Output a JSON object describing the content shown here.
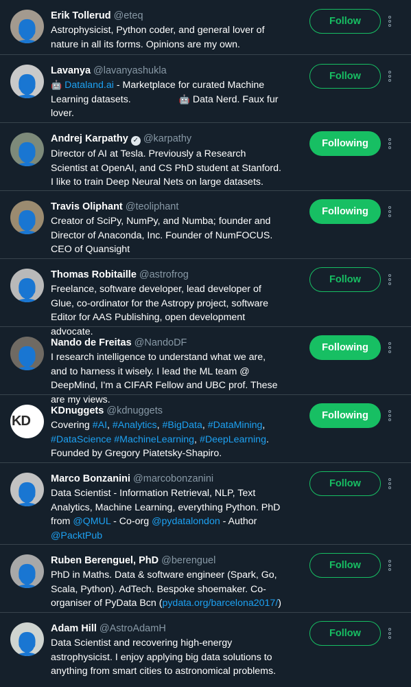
{
  "users": [
    {
      "name": "Erik Tollerud",
      "handle": "@eteq",
      "bio": "Astrophysicist, Python coder, and general lover of nature in all its forms. Opinions are my own.",
      "button": "Follow",
      "state": "follow"
    },
    {
      "name": "Lavanya",
      "handle": "@lavanyashukla",
      "bio_link": "Dataland.ai",
      "bio_pre_emoji": "robot-icon",
      "bio": " - Marketplace for curated Machine Learning datasets.",
      "bio_emoji2": "robot-icon",
      "bio_tail": "Data Nerd. Faux fur lover.",
      "button": "Follow",
      "state": "follow"
    },
    {
      "name": "Andrej Karpathy",
      "handle": "@karpathy",
      "verified": true,
      "bio": "Director of AI at Tesla. Previously a Research Scientist at OpenAI, and CS PhD student at Stanford. I like to train Deep Neural Nets on large datasets.",
      "button": "Following",
      "state": "following"
    },
    {
      "name": "Travis Oliphant",
      "handle": "@teoliphant",
      "bio": "Creator of SciPy, NumPy, and Numba; founder and Director of Anaconda, Inc. Founder of NumFOCUS. CEO of Quansight",
      "button": "Following",
      "state": "following"
    },
    {
      "name": "Thomas Robitaille",
      "handle": "@astrofrog",
      "bio": "Freelance, software developer, lead developer of Glue, co-ordinator for the Astropy project, software Editor for AAS Publishing, open development advocate.",
      "button": "Follow",
      "state": "follow"
    },
    {
      "name": "Nando de Freitas",
      "handle": "@NandoDF",
      "bio": "I research intelligence to understand what we are, and to harness it wisely. I lead the ML team @ DeepMind, I'm a CIFAR Fellow and UBC prof. These are my views.",
      "button": "Following",
      "state": "following"
    },
    {
      "name": "KDnuggets",
      "handle": "@kdnuggets",
      "bio_prefix": "Covering ",
      "bio_tags": [
        "#AI",
        "#Analytics",
        "#BigData",
        "#DataMining",
        "#DataScience",
        "#MachineLearning",
        "#DeepLearning"
      ],
      "bio_suffix": "Founded by Gregory Piatetsky-Shapiro.",
      "avatar_text": "KD",
      "button": "Following",
      "state": "following"
    },
    {
      "name": "Marco Bonzanini",
      "handle": "@marcobonzanini",
      "bio": "Data Scientist - Information Retrieval, NLP, Text Analytics, Machine Learning, everything Python. PhD from ",
      "bio_link1": "@QMUL",
      "bio_mid": " - Co-org ",
      "bio_link2": "@pydatalondon",
      "bio_mid2": " - Author ",
      "bio_link3": "@PacktPub",
      "button": "Follow",
      "state": "follow"
    },
    {
      "name": "Ruben Berenguel, PhD",
      "handle": "@berenguel",
      "bio": "PhD in Maths. Data & software engineer (Spark, Go, Scala, Python). AdTech. Bespoke shoemaker. Co-organiser of PyData Bcn (",
      "bio_link": "pydata.org/barcelona2017/",
      "bio_end": ")",
      "button": "Follow",
      "state": "follow"
    },
    {
      "name": "Adam Hill",
      "handle": "@AstroAdamH",
      "bio": "Data Scientist and recovering high-energy astrophysicist. I enjoy applying big data solutions to anything from smart cities to astronomical problems.",
      "button": "Follow",
      "state": "follow"
    }
  ],
  "icons": {
    "more": "more-vertical-icon",
    "verified": "verified-badge-icon"
  },
  "colors": {
    "background": "#15202b",
    "accent_green": "#17bf63",
    "link_blue": "#1da1f2",
    "muted": "#8899a6",
    "divider": "#38444d"
  }
}
